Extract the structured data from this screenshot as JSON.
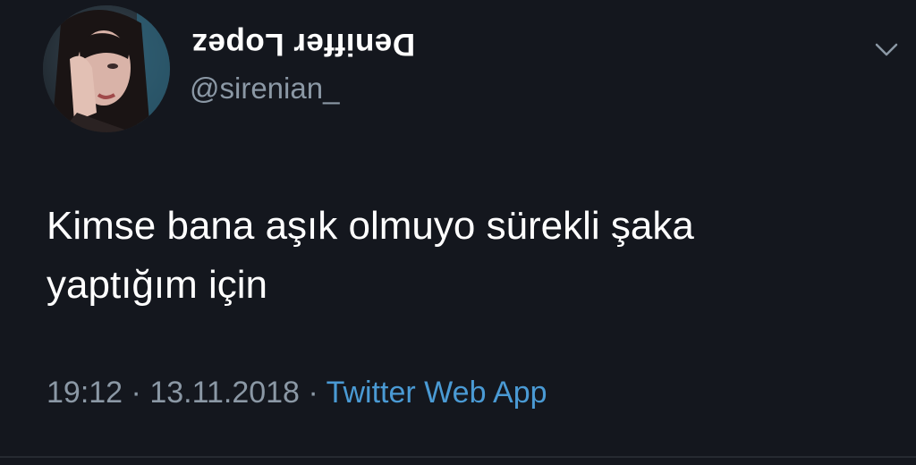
{
  "tweet": {
    "display_name": "Deniffer Lopez",
    "handle": "@sirenian_",
    "text": "Kimse bana aşık olmuyo sürekli şaka\nyaptığım için",
    "time": "19:12",
    "separator": "·",
    "date": "13.11.2018",
    "source": "Twitter Web App"
  },
  "icons": {
    "menu": "chevron-down-icon",
    "avatar": "profile-photo"
  },
  "colors": {
    "background": "#14171e",
    "text": "#ffffff",
    "muted": "#8b98a5",
    "link": "#4a9ad4"
  }
}
